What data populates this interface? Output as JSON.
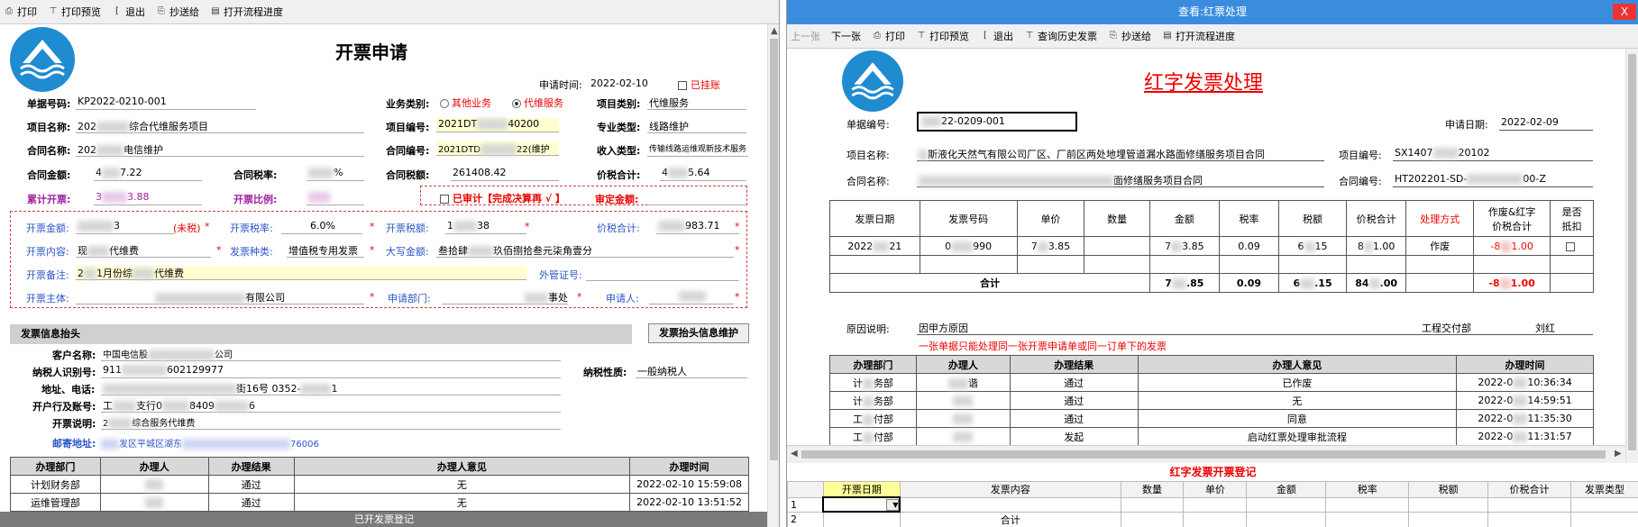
{
  "left": {
    "toolbar": [
      {
        "icon": "print-icon",
        "label": "打印"
      },
      {
        "icon": "preview-icon",
        "label": "打印预览"
      },
      {
        "icon": "exit-icon",
        "label": "退出"
      },
      {
        "icon": "copy-send-icon",
        "label": "抄送给"
      },
      {
        "icon": "flow-icon",
        "label": "打开流程进度"
      }
    ],
    "title": "开票申请",
    "apply_time_label": "申请时间:",
    "apply_time": "2022-02-10",
    "hung_label": "已挂账",
    "doc_no_label": "单据号码:",
    "doc_no": "KP2022-0210-001",
    "biz_type_label": "业务类别:",
    "biz_type_options": [
      "其他业务",
      "代维服务"
    ],
    "project_type_label": "项目类别:",
    "project_type": "代维服务",
    "project_name_label": "项目名称:",
    "project_name_a": "202",
    "project_name_b": "综合代维服务项目",
    "project_no_label": "项目编号:",
    "project_no_a": "2021DT",
    "project_no_b": "40200",
    "major_type_label": "专业类型:",
    "major_type": "线路维护",
    "contract_name_label": "合同名称:",
    "contract_name_a": "202",
    "contract_name_b": "电信维护",
    "contract_no_label": "合同编号:",
    "contract_no_a": "2021DTD",
    "contract_no_b": "22(维护",
    "income_type_label": "收入类型:",
    "income_type": "传输线路运维观新技术服务",
    "contract_amount_label": "合同金额:",
    "contract_amount_a": "4",
    "contract_amount_b": "7.22",
    "contract_rate_label": "合同税率:",
    "contract_rate_b": "%",
    "contract_tax_label": "合同税额:",
    "contract_tax": "261408.42",
    "price_total_label": "价税合计:",
    "price_total_a": "4",
    "price_total_b": "5.64",
    "cum_invoice_label": "累计开票:",
    "cum_invoice_a": "3",
    "cum_invoice_b": "3.88",
    "invoice_ratio_label": "开票比例:",
    "audited_label": "已审计【完成决算再 √ 】",
    "audit_amount_label": "审定金额:",
    "inv_amount_label": "开票金额:",
    "inv_amount_b": "3",
    "untaxed": "(未税)",
    "inv_rate_label": "开票税率:",
    "inv_rate": "6.0%",
    "inv_tax_label": "开票税额:",
    "inv_tax_a": "1",
    "inv_tax_b": "38",
    "inv_total_label": "价税合计:",
    "inv_total_b": "983.71",
    "inv_content_label": "开票内容:",
    "inv_content_a": "现",
    "inv_content_b": "代维费",
    "inv_kind_label": "发票种类:",
    "inv_kind": "增值税专用发票",
    "upper_amount_label": "大写金额:",
    "upper_amount_a": "叁拾肆",
    "upper_amount_b": "玖佰捌拾叁元柒角壹分",
    "inv_note_label": "开票备注:",
    "inv_note_a": "2",
    "inv_note_b": "1月份综",
    "inv_note_c": "代维费",
    "foreign_cert_label": "外管证号:",
    "inv_subject_label": "开票主体:",
    "inv_subject_b": "有限公司",
    "apply_dept_label": "申请部门:",
    "apply_dept_b": "事处",
    "applicant_label": "申请人:",
    "header_section": "发票信息抬头",
    "header_btn": "发票抬头信息维护",
    "customer_label": "客户名称:",
    "customer_a": "中国电信股",
    "customer_b": "公司",
    "taxpayer_no_label": "纳税人识别号:",
    "taxpayer_no_a": "911",
    "taxpayer_no_b": "602129977",
    "taxpayer_type_label": "纳税性质:",
    "taxpayer_type": "一般纳税人",
    "address_label": "地址、电话:",
    "address_b": "街16号 0352-",
    "address_c": "1",
    "bank_label": "开户行及账号:",
    "bank_a": "工",
    "bank_b": "支行0",
    "bank_c": "8409",
    "bank_d": "6",
    "inv_desc_label": "开票说明:",
    "inv_desc_a": "2",
    "inv_desc_b": "综合服务代维费",
    "mail_label": "邮寄地址:",
    "mail_b": "发区平城区湖东",
    "mail_c": "76006",
    "approval_headers": [
      "办理部门",
      "办理人",
      "办理结果",
      "办理人意见",
      "办理时间"
    ],
    "approval_rows": [
      {
        "dept": "计划财务部",
        "result": "通过",
        "opinion": "无",
        "time": "2022-02-10 15:59:08"
      },
      {
        "dept": "运维管理部",
        "result": "通过",
        "opinion": "无",
        "time": "2022-02-10 13:51:52"
      }
    ],
    "bottom_bar": "已开发票登记"
  },
  "right": {
    "window_title": "查看:红票处理",
    "close": "X",
    "toolbar": [
      {
        "icon": "prev-icon",
        "label": "上一张",
        "disabled": true
      },
      {
        "icon": "next-icon",
        "label": "下一张",
        "disabled": false
      },
      {
        "icon": "print-icon",
        "label": "打印",
        "disabled": false
      },
      {
        "icon": "preview-icon",
        "label": "打印预览",
        "disabled": false
      },
      {
        "icon": "exit-icon",
        "label": "退出",
        "disabled": false
      },
      {
        "icon": "history-icon",
        "label": "查询历史发票",
        "disabled": false
      },
      {
        "icon": "copy-send-icon",
        "label": "抄送给",
        "disabled": false
      },
      {
        "icon": "flow-icon",
        "label": "打开流程进度",
        "disabled": false
      }
    ],
    "title": "红字发票处理",
    "doc_no_label": "单据编号:",
    "doc_no_b": "22-0209-001",
    "apply_date_label": "申请日期:",
    "apply_date": "2022-02-09",
    "project_name_label": "项目名称:",
    "project_name_b": "斯液化天然气有限公司厂区、厂前区两处地埋管道漏水路面修缮服务项目合同",
    "project_no_label": "项目编号:",
    "project_no_a": "SX1407",
    "project_no_b": "20102",
    "contract_name_label": "合同名称:",
    "contract_name_b": "面修缮服务项目合同",
    "contract_no_label": "合同编号:",
    "contract_no_a": "HT202201-SD-",
    "contract_no_b": "00-Z",
    "inv_headers": [
      "发票日期",
      "发票号码",
      "单价",
      "数量",
      "金额",
      "税率",
      "税额",
      "价税合计",
      "处理方式",
      "作废&红字\n价税合计",
      "是否\n抵扣"
    ],
    "inv_row": {
      "date_a": "2022",
      "date_b": "21",
      "no_a": "0",
      "no_b": "990",
      "price_a": "7",
      "price_b": "3.85",
      "qty": "",
      "amount_a": "7",
      "amount_b": "3.85",
      "rate": "0.09",
      "tax_a": "6",
      "tax_b": "15",
      "total_a": "8",
      "total_b": "1.00",
      "method": "作废",
      "red_a": "-8",
      "red_b": "1.00"
    },
    "sum_label": "合计",
    "sum_row": {
      "amount_a": "7",
      "amount_b": ".85",
      "rate": "0.09",
      "tax_a": "6",
      "tax_b": ".15",
      "total_a": "84",
      "total_b": ".00",
      "red_a": "-8",
      "red_b": "1.00"
    },
    "reason_label": "原因说明:",
    "reason": "因甲方原因",
    "dept": "工程交付部",
    "person": "刘红",
    "warning": "一张单据只能处理同一张开票申请单或同一订单下的发票",
    "approval_headers": [
      "办理部门",
      "办理人",
      "办理结果",
      "办理人意见",
      "办理时间"
    ],
    "approval_rows": [
      {
        "dept_a": "计",
        "dept_b": "务部",
        "person_b": "谐",
        "result": "通过",
        "opinion": "已作废",
        "time_a": "2022-0",
        "time_b": "10:36:34"
      },
      {
        "dept_a": "计",
        "dept_b": "务部",
        "person_b": "",
        "result": "通过",
        "opinion": "无",
        "time_a": "2022-0",
        "time_b": "14:59:51"
      },
      {
        "dept_a": "工",
        "dept_b": "付部",
        "person_b": "",
        "result": "通过",
        "opinion": "同意",
        "time_a": "2022-0",
        "time_b": "11:35:30"
      },
      {
        "dept_a": "工",
        "dept_b": "付部",
        "person_b": "",
        "result": "发起",
        "opinion": "启动红票处理审批流程",
        "time_a": "2022-0",
        "time_b": "11:31:57"
      }
    ],
    "reg_title": "红字发票开票登记",
    "reg_headers": [
      "开票日期",
      "发票内容",
      "数量",
      "单价",
      "金额",
      "税率",
      "税额",
      "价税合计",
      "发票类型"
    ],
    "reg_rows": [
      "1",
      "2"
    ],
    "reg_sum_label": "合计"
  },
  "colors": {
    "accent": "#1f8bd1",
    "red": "#e00000",
    "titlebar": "#3a8dde",
    "highlight": "#ffffd2"
  }
}
